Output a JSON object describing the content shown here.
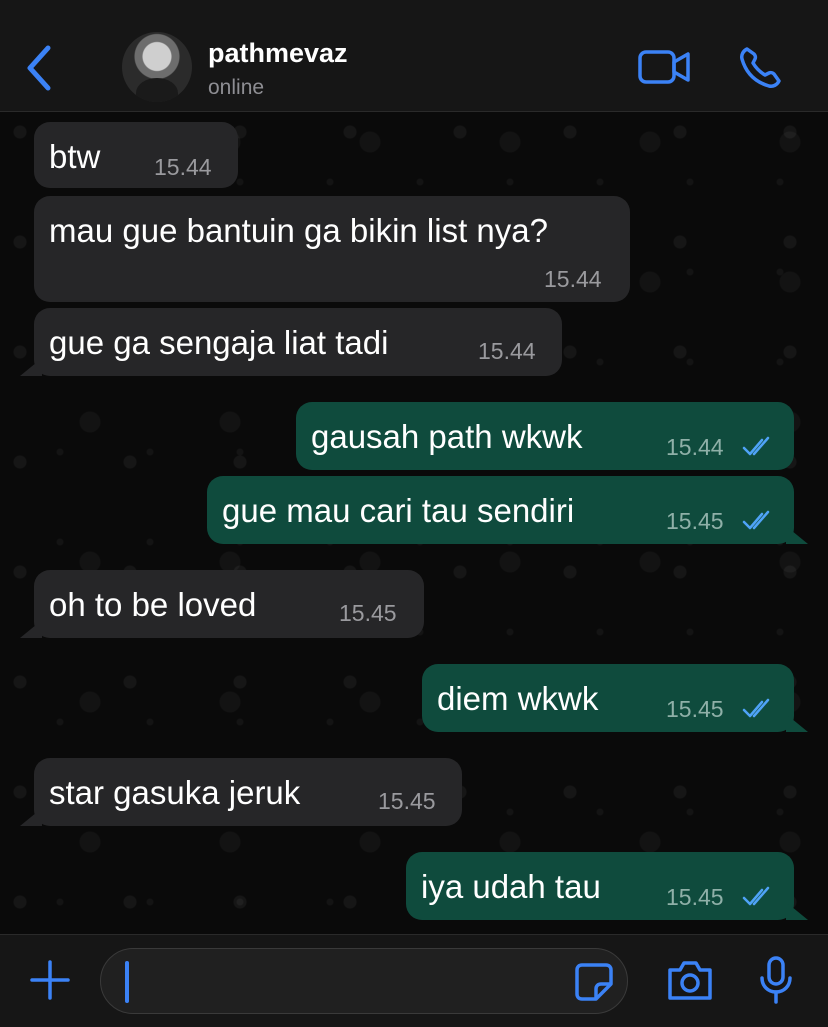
{
  "header": {
    "contact_name": "pathmevaz",
    "status": "online",
    "icons": [
      "chevron-left-icon",
      "avatar",
      "video-camera-icon",
      "phone-icon"
    ]
  },
  "messages": [
    {
      "dir": "in",
      "text": "btw",
      "time": "15.44"
    },
    {
      "dir": "in",
      "text": "mau gue bantuin ga bikin list nya?",
      "time": "15.44"
    },
    {
      "dir": "in",
      "text": "gue ga sengaja liat tadi",
      "time": "15.44"
    },
    {
      "dir": "out",
      "text": "gausah path wkwk",
      "time": "15.44",
      "read": true
    },
    {
      "dir": "out",
      "text": "gue mau cari tau sendiri",
      "time": "15.45",
      "read": true
    },
    {
      "dir": "in",
      "text": "oh to be loved",
      "time": "15.45"
    },
    {
      "dir": "out",
      "text": "diem wkwk",
      "time": "15.45",
      "read": true
    },
    {
      "dir": "in",
      "text": "star gasuka jeruk",
      "time": "15.45"
    },
    {
      "dir": "out",
      "text": "iya udah tau",
      "time": "15.45",
      "read": true
    }
  ],
  "input": {
    "value": "",
    "icons": [
      "plus-icon",
      "sticker-icon",
      "camera-icon",
      "microphone-icon"
    ]
  },
  "colors": {
    "accent": "#3b82f6",
    "incoming_bubble": "#262628",
    "outgoing_bubble": "#0f4b3d",
    "read_ticks": "#4fa3f7"
  }
}
